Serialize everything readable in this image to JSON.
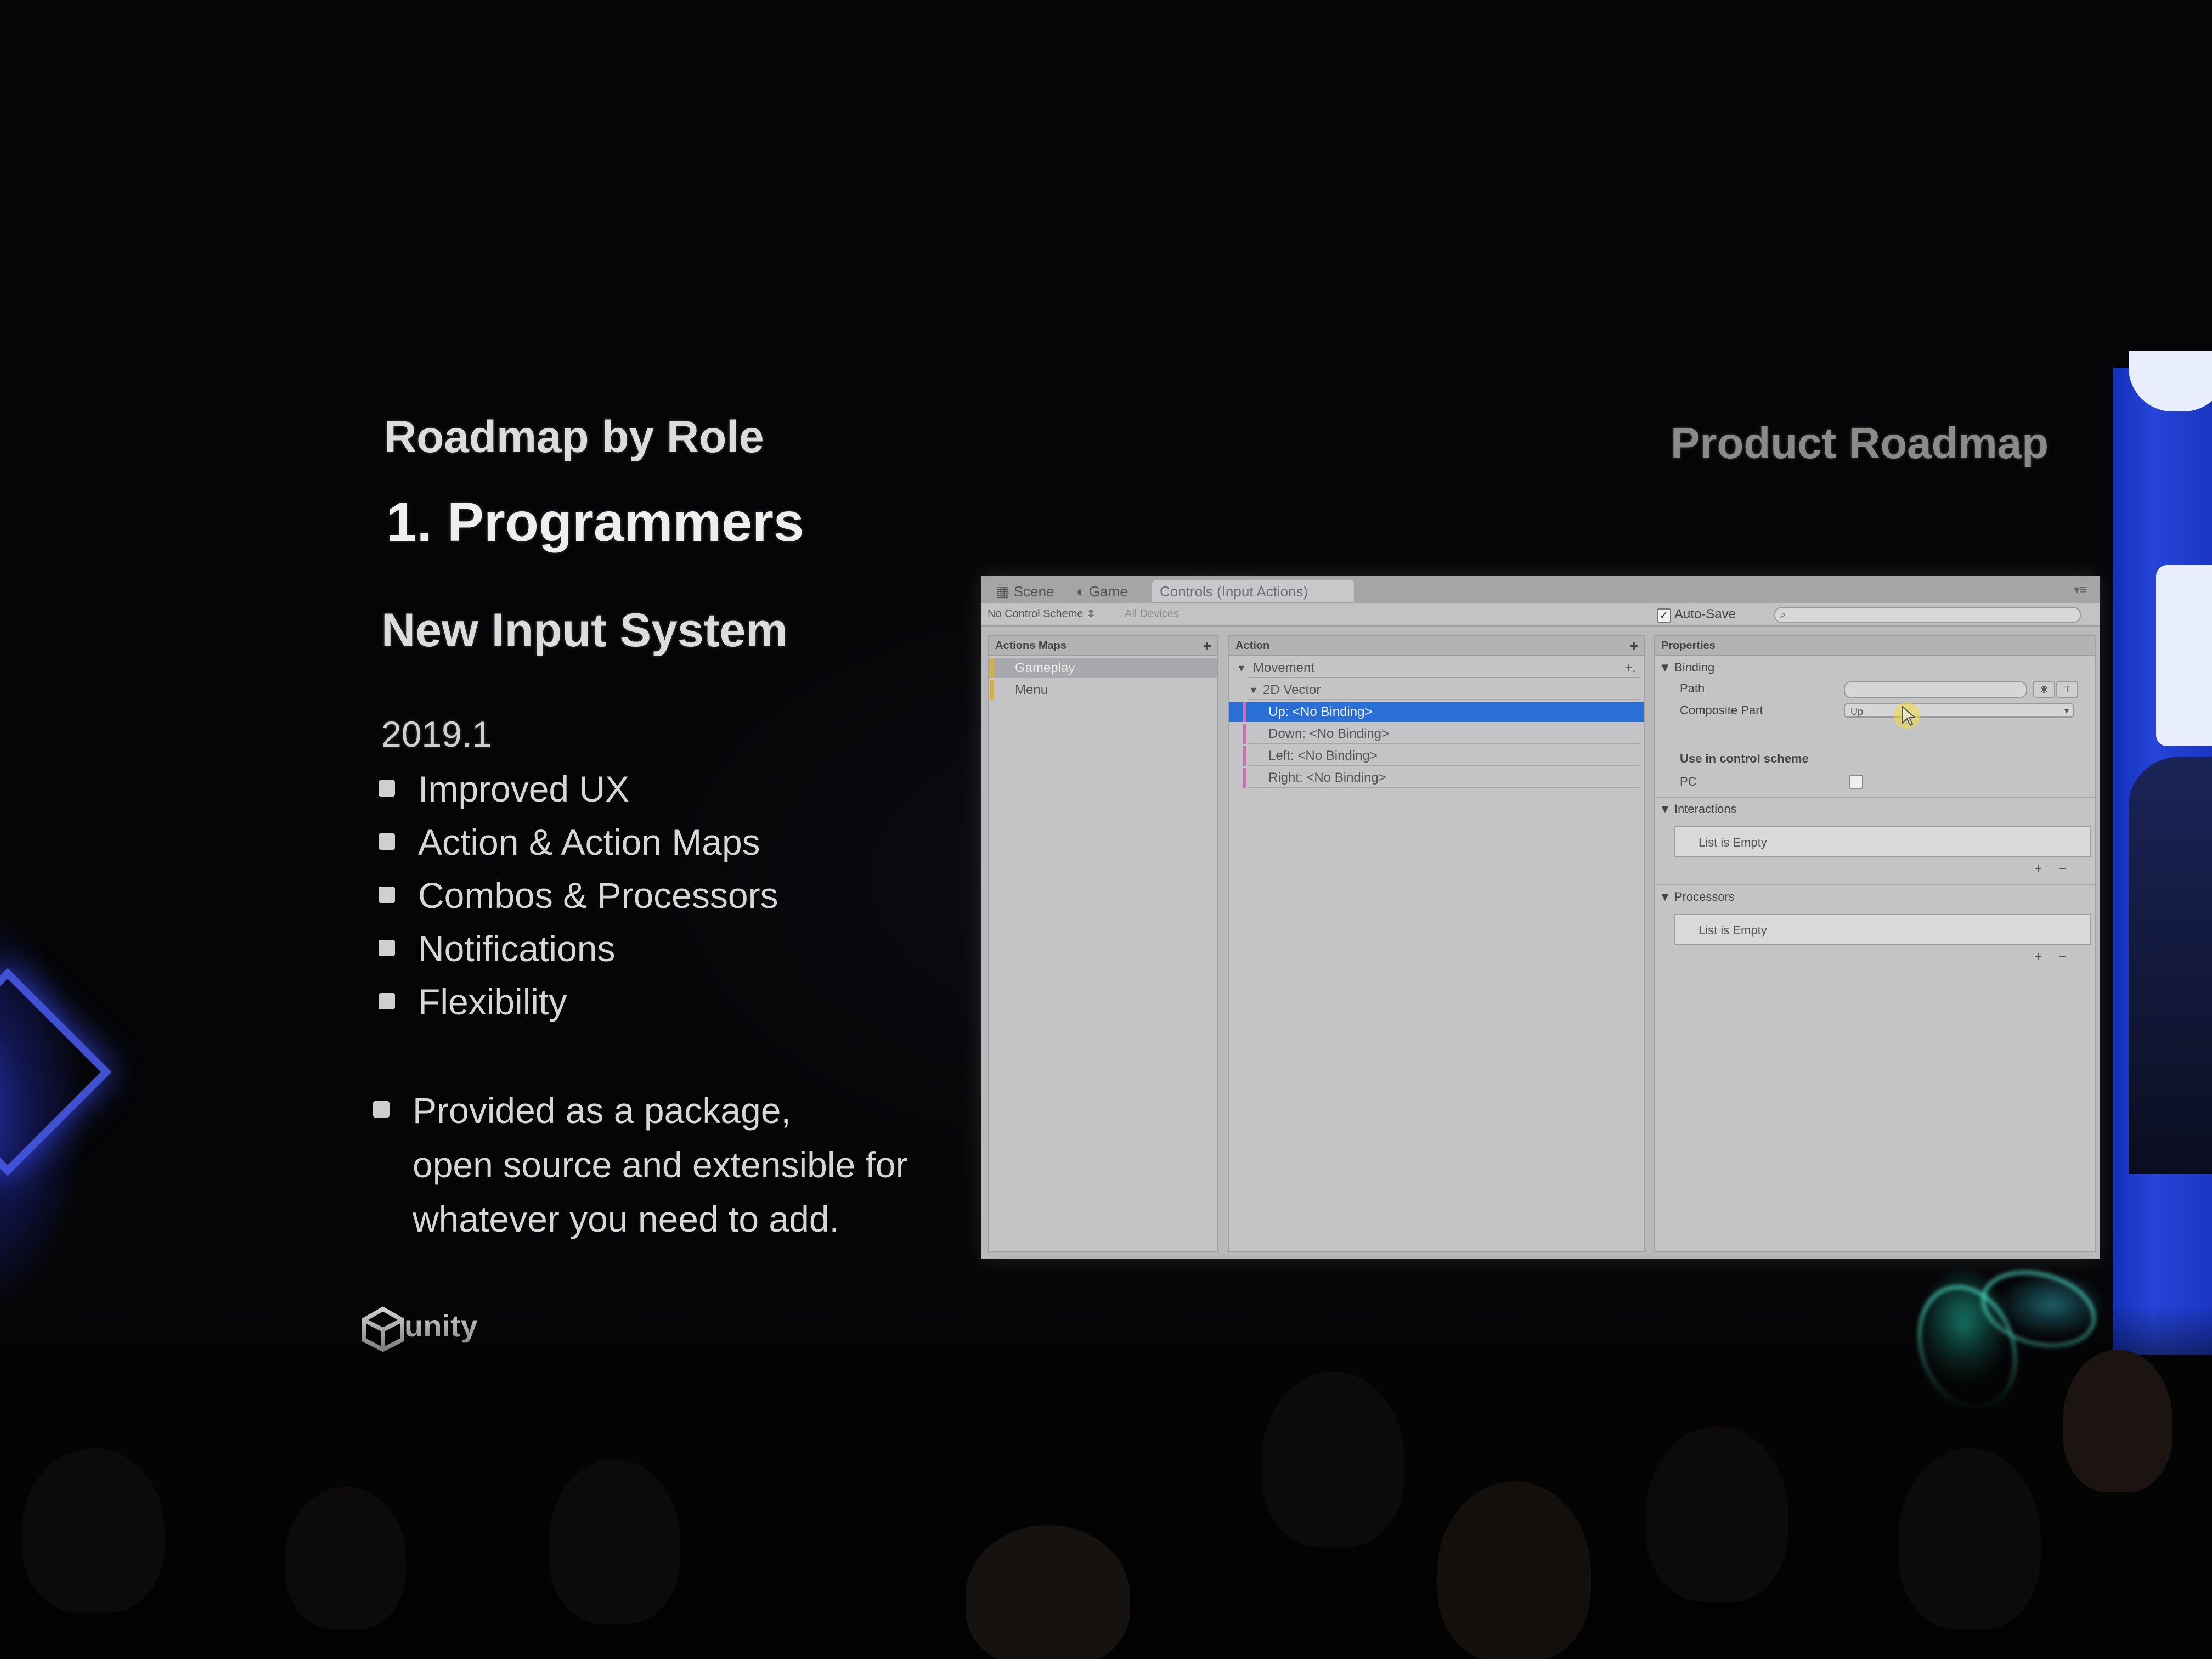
{
  "slide": {
    "section": "Roadmap by Role",
    "topic": "1. Programmers",
    "corner_title": "Product Roadmap",
    "feature": "New Input System",
    "version": "2019.1",
    "bullets": [
      "Improved UX",
      "Action & Action Maps",
      "Combos & Processors",
      "Notifications",
      "Flexibility"
    ],
    "note": "Provided as a package,\nopen source and extensible for\nwhatever you need to add.",
    "brand": "unity"
  },
  "editor": {
    "tabs": [
      "Scene",
      "Game",
      "Controls (Input Actions)"
    ],
    "control_scheme": "No Control Scheme",
    "devices": "All Devices",
    "autosave_label": "Auto-Save",
    "action_maps": {
      "header": "Actions Maps",
      "items": [
        "Gameplay",
        "Menu"
      ]
    },
    "actions": {
      "header": "Action",
      "rows": [
        "Movement",
        "2D Vector",
        "Up: <No Binding>",
        "Down: <No Binding>",
        "Left: <No Binding>",
        "Right: <No Binding>"
      ]
    },
    "properties": {
      "header": "Properties",
      "binding_section": "Binding",
      "path_label": "Path",
      "composite_label": "Composite Part",
      "composite_value": "Up",
      "scheme_section": "Use in control scheme",
      "scheme_pc": "PC",
      "interactions_section": "Interactions",
      "interactions_empty": "List is Empty",
      "processors_section": "Processors",
      "processors_empty": "List is Empty"
    }
  },
  "colors": {
    "background": "#050507",
    "selection": "#2a6fd6",
    "map_stripe": "#d4b044",
    "binding_stripe": "#c96fb4",
    "stage_blue": "#2544d8"
  }
}
